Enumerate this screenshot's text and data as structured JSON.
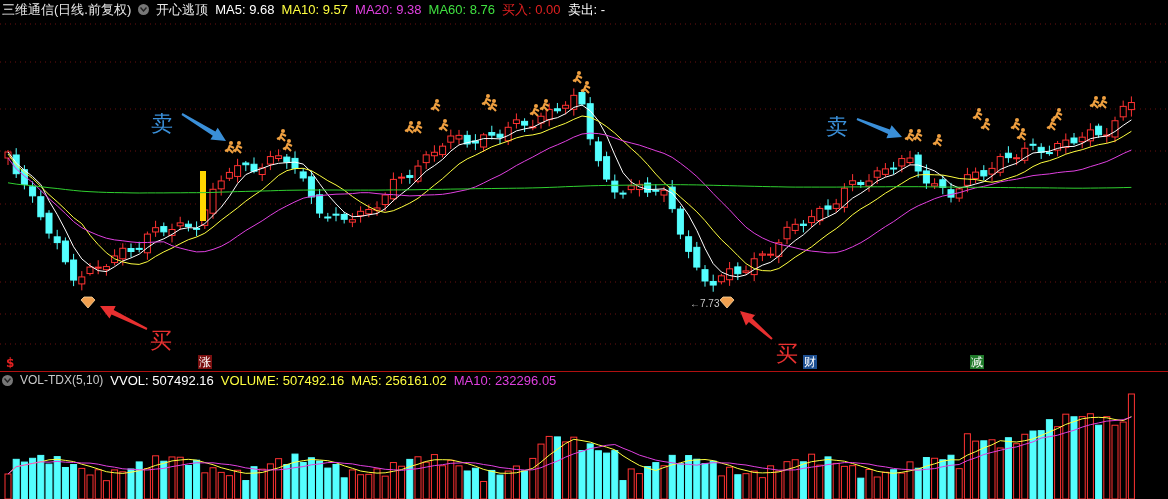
{
  "header": {
    "title": "三维通信(日线.前复权)",
    "indicator_name": "开心逃顶",
    "values": [
      {
        "label": "MA5: 9.68",
        "color": "#ffffff"
      },
      {
        "label": "MA10: 9.57",
        "color": "#ffff40"
      },
      {
        "label": "MA20: 9.38",
        "color": "#e040e0"
      },
      {
        "label": "MA60: 8.76",
        "color": "#40e040"
      },
      {
        "label": "买入: 0.00",
        "color": "#e02020"
      },
      {
        "label": "卖出: -",
        "color": "#ffffff"
      }
    ]
  },
  "main_chart": {
    "annotations": [
      {
        "kind": "sell",
        "label": "卖"
      },
      {
        "kind": "buy",
        "label": "买"
      },
      {
        "kind": "buy",
        "label": "买"
      },
      {
        "kind": "sell",
        "label": "卖"
      }
    ],
    "price_note": "←7.73",
    "events": [
      {
        "kind": "plain",
        "label": "$",
        "color": "#e02020"
      },
      {
        "kind": "tag",
        "label": "涨",
        "color": "#7a1010"
      },
      {
        "kind": "tag",
        "label": "财",
        "color": "#1d4f91"
      },
      {
        "kind": "tag",
        "label": "减",
        "color": "#1f7a2a"
      }
    ]
  },
  "volume_panel": {
    "title": "VOL-TDX(5,10)",
    "values": [
      {
        "label": "VVOL: 507492.16",
        "color": "#ffffff"
      },
      {
        "label": "VOLUME: 507492.16",
        "color": "#ffff40"
      },
      {
        "label": "MA5: 256161.02",
        "color": "#ffff40"
      },
      {
        "label": "MA10: 232296.05",
        "color": "#e040e0"
      }
    ]
  }
}
